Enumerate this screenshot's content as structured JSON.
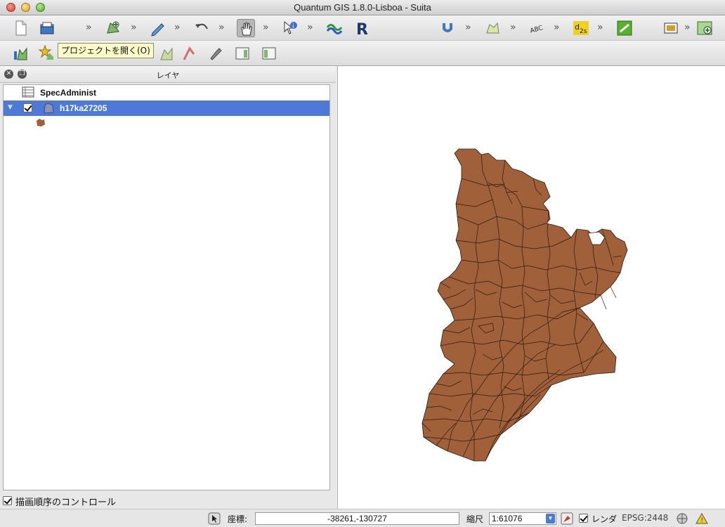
{
  "window": {
    "title": "Quantum GIS 1.8.0-Lisboa - Suita"
  },
  "tooltip": {
    "text": "プロジェクトを開く(O)"
  },
  "toolbar": {
    "more_glyph": "»",
    "row1_icons": [
      "new-project-icon",
      "open-project-icon",
      "add-vector-icon",
      "edit-pencil-icon",
      "undo-icon",
      "pan-hand-icon",
      "identify-icon",
      "digitize-icon",
      "r-plugin-icon",
      "snap-magnet-icon",
      "node-tool-icon",
      "label-abc-icon",
      "d2s-icon",
      "python-plugin-icon",
      "print-composer-icon",
      "add-map-icon"
    ],
    "row2_icons": [
      "add-layer-icon",
      "add-star-layer-icon",
      "layer-a-icon",
      "layer-b-icon",
      "layer-c-icon",
      "layer-d-icon",
      "wrench-icon",
      "hammer-icon",
      "panel-icon-1",
      "panel-icon-2"
    ]
  },
  "layers_panel": {
    "title": "レイヤ",
    "layers": [
      {
        "name": "SpecAdminist",
        "type": "table",
        "checked": false,
        "selected": false
      },
      {
        "name": "h17ka27205",
        "type": "polygon",
        "checked": true,
        "selected": true,
        "expanded": true
      }
    ],
    "draw_order_label": "描画順序のコントロール",
    "draw_order_checked": true
  },
  "map": {
    "fill_color": "#a0603a",
    "stroke_color": "#2a1a10",
    "background": "#ffffff"
  },
  "statusbar": {
    "coord_label": "座標:",
    "coord_value": "-38261,-130727",
    "scale_label": "縮尺",
    "scale_value": "1:61076",
    "render_label": "レンダ",
    "render_checked": true,
    "crs": "EPSG:2448"
  },
  "colors": {
    "selection": "#4f79d9",
    "tooltip_bg": "#fdfdc8"
  }
}
